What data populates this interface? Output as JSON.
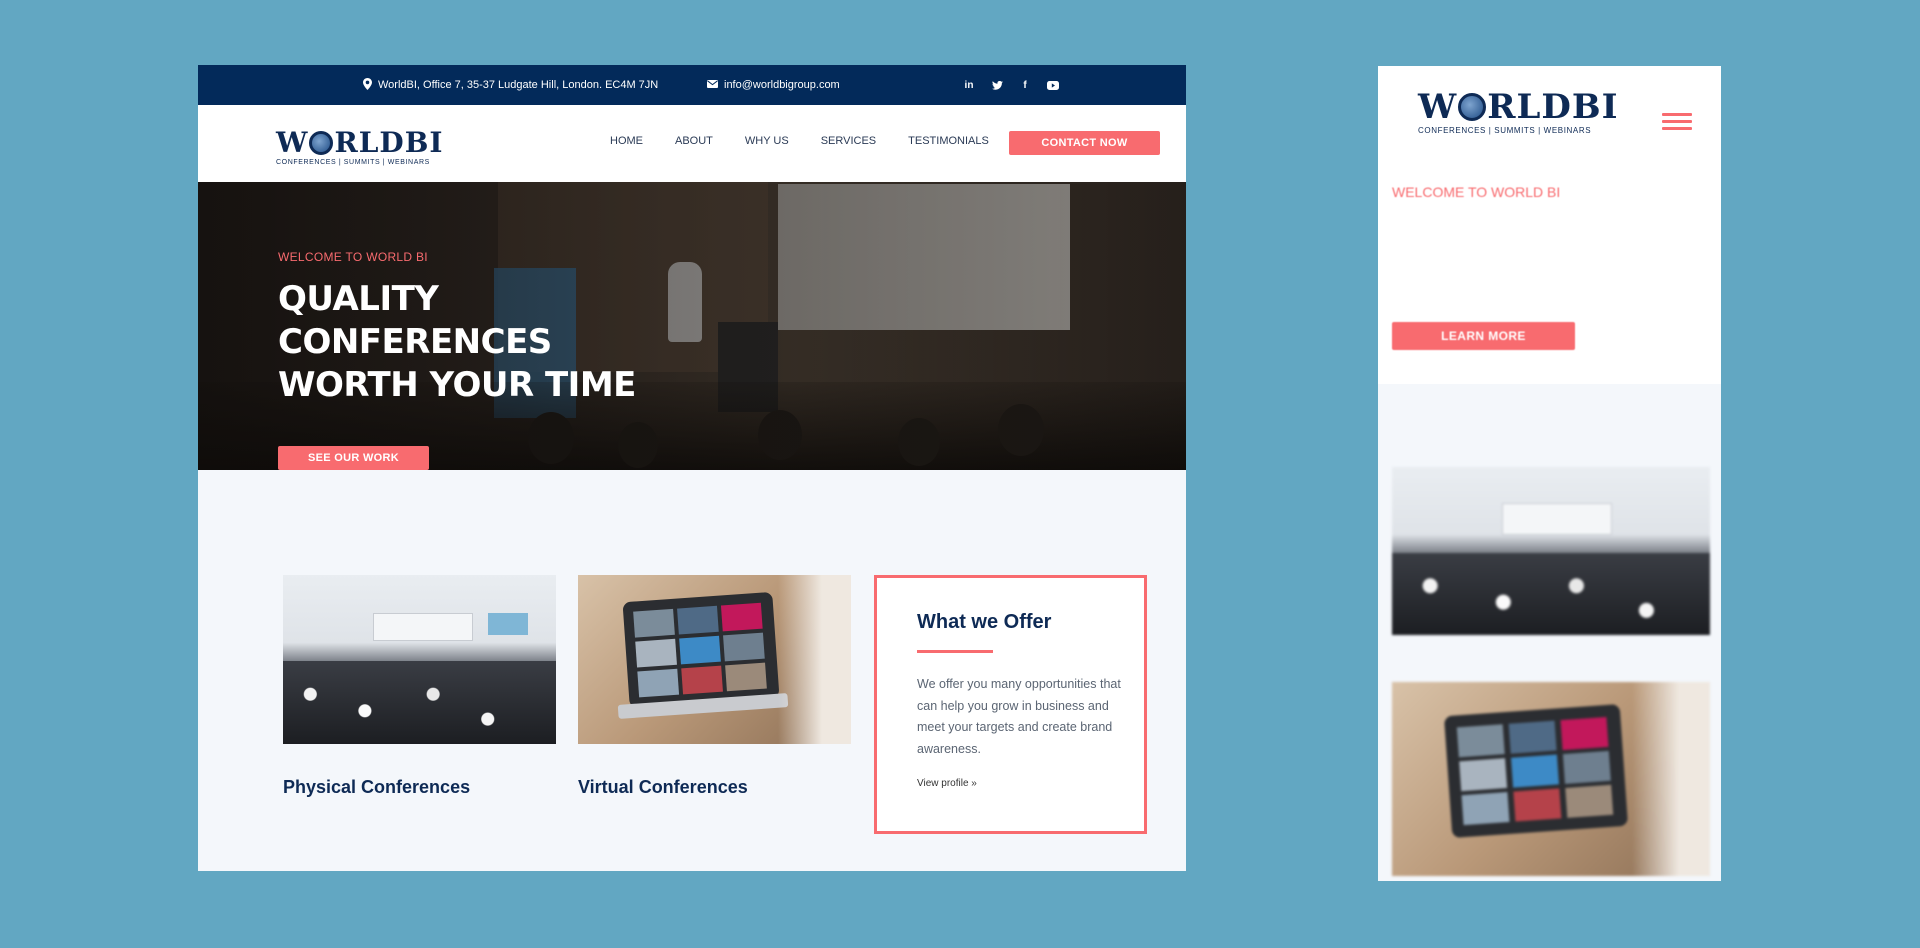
{
  "topbar": {
    "address": "WorldBI, Office 7, 35-37 Ludgate Hill, London. EC4M 7JN",
    "email": "info@worldbigroup.com",
    "socials": [
      "linkedin-icon",
      "twitter-icon",
      "facebook-icon",
      "youtube-icon"
    ]
  },
  "brand": {
    "logo_left": "W",
    "logo_right": "RLDBI",
    "tagline": "CONFERENCES | SUMMITS | WEBINARS"
  },
  "nav": {
    "items": [
      "HOME",
      "ABOUT",
      "WHY US",
      "SERVICES",
      "TESTIMONIALS"
    ],
    "contact_label": "CONTACT NOW"
  },
  "hero": {
    "eyebrow": "WELCOME TO WORLD BI",
    "title_line1": "QUALITY",
    "title_line2": "CONFERENCES",
    "title_line3": "WORTH YOUR TIME",
    "cta_label": "SEE OUR WORK"
  },
  "services": {
    "physical_title": "Physical Conferences",
    "virtual_title": "Virtual Conferences"
  },
  "offer": {
    "title": "What we Offer",
    "text": "We offer you many opportunities that can help you grow in business and meet your targets and create brand awareness.",
    "link": "View profile »"
  },
  "mobile": {
    "eyebrow": "WELCOME TO WORLD BI",
    "cta_label": "LEARN MORE"
  },
  "colors": {
    "navy": "#032a5a",
    "accent": "#f86b6f",
    "page_bg": "#62a7c2"
  }
}
